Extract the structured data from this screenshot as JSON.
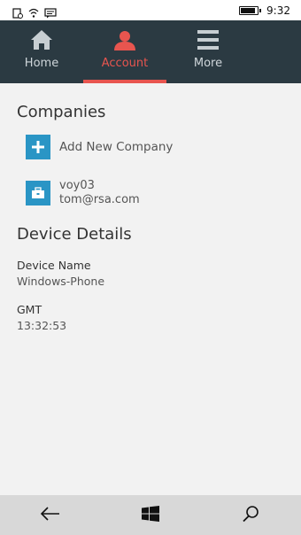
{
  "status_bar": {
    "time": "9:32",
    "battery_level": 0.95,
    "icons": [
      "notification-phone-icon",
      "wifi-icon",
      "message-icon",
      "battery-icon"
    ]
  },
  "nav": {
    "items": [
      {
        "label": "Home",
        "icon": "home-icon",
        "active": false
      },
      {
        "label": "Account",
        "icon": "person-icon",
        "active": true
      },
      {
        "label": "More",
        "icon": "menu-icon",
        "active": false
      }
    ],
    "active_color": "#e8554f",
    "background": "#2b3a42"
  },
  "companies": {
    "title": "Companies",
    "add_label": "Add New Company",
    "items": [
      {
        "name": "voy03",
        "email": "tom@rsa.com"
      }
    ]
  },
  "device": {
    "title": "Device Details",
    "name_label": "Device Name",
    "name_value": "Windows-Phone",
    "gmt_label": "GMT",
    "gmt_value": "13:32:53"
  },
  "system_bar": {
    "buttons": [
      "back-arrow-icon",
      "windows-logo-icon",
      "search-icon"
    ]
  },
  "colors": {
    "tile_blue": "#2a95c5",
    "accent_red": "#e8554f"
  }
}
